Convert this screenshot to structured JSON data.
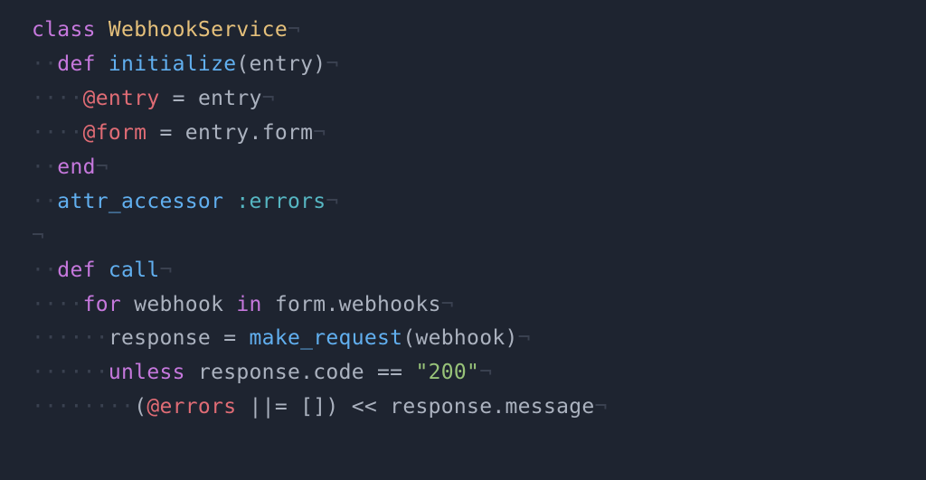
{
  "code": {
    "line1": {
      "kw_class": "class",
      "className": "WebhookService",
      "ws": "¬"
    },
    "line2": {
      "indent": "··",
      "kw_def": "def",
      "methodName": "initialize",
      "lparen": "(",
      "param": "entry",
      "rparen": ")",
      "ws": "¬"
    },
    "line3": {
      "indent": "····",
      "ivar": "@entry",
      "op": " = ",
      "var": "entry",
      "ws": "¬"
    },
    "line4": {
      "indent": "····",
      "ivar": "@form",
      "op": " = ",
      "var": "entry",
      "dot": ".",
      "prop": "form",
      "ws": "¬"
    },
    "line5": {
      "indent": "··",
      "kw_end": "end",
      "ws": "¬"
    },
    "line6": {
      "indent": "··",
      "attr": "attr_accessor",
      "space": " ",
      "symbol": ":errors",
      "ws": "¬"
    },
    "line7": {
      "ws": "¬"
    },
    "line8": {
      "indent": "··",
      "kw_def": "def",
      "methodName": "call",
      "ws": "¬"
    },
    "line9": {
      "indent": "····",
      "kw_for": "for",
      "var1": "webhook",
      "kw_in": "in",
      "var2": "form",
      "dot": ".",
      "prop": "webhooks",
      "ws": "¬"
    },
    "line10": {
      "indent": "······",
      "var": "response",
      "op": " = ",
      "method": "make_request",
      "lparen": "(",
      "arg": "webhook",
      "rparen": ")",
      "ws": "¬"
    },
    "line11": {
      "indent": "······",
      "kw_unless": "unless",
      "var": "response",
      "dot": ".",
      "prop": "code",
      "op": " == ",
      "string": "\"200\"",
      "ws": "¬"
    },
    "line12": {
      "indent": "········",
      "lparen": "(",
      "ivar": "@errors",
      "op1": " ||= ",
      "brackets": "[]",
      "rparen": ")",
      "op2": " << ",
      "var": "response",
      "dot": ".",
      "prop": "message",
      "ws": "¬"
    }
  }
}
